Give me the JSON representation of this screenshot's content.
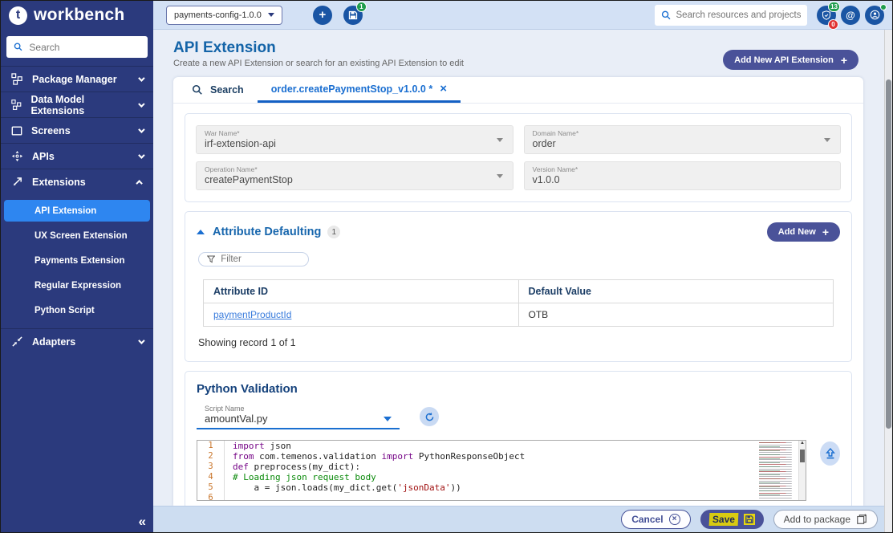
{
  "colors": {
    "navy": "#2b3a7d",
    "selected_blue": "#2e86f0",
    "indigo_button": "#4a5299",
    "title_blue": "#1464a8",
    "tab_active": "#1b6fd1",
    "link_blue": "#3b7ddd",
    "topbar_bg": "#d3e1f5",
    "footer_bg": "#cdddf1",
    "badge_green": "#1f9d4d",
    "badge_red": "#e03131",
    "save_highlight": "#d8ca12"
  },
  "glyphs": {
    "logo": "t",
    "plus": "+",
    "at": "@",
    "collapse": "«",
    "close": "×",
    "save_plus": "+"
  },
  "topbar": {
    "logo_text": "workbench",
    "project_selector": "payments-config-1.0.0",
    "package_badge": "1",
    "search_placeholder": "Search resources and projects",
    "notif_badge_top": "13",
    "notif_badge_bottom": "0"
  },
  "sidebar": {
    "search_placeholder": "Search",
    "items": [
      {
        "label": "Package Manager"
      },
      {
        "label": "Data Model Extensions"
      },
      {
        "label": "Screens"
      },
      {
        "label": "APIs"
      },
      {
        "label": "Extensions"
      },
      {
        "label": "Adapters"
      }
    ],
    "extensions_children": [
      {
        "label": "API Extension",
        "active": true
      },
      {
        "label": "UX Screen Extension"
      },
      {
        "label": "Payments Extension"
      },
      {
        "label": "Regular Expression"
      },
      {
        "label": "Python Script"
      }
    ]
  },
  "page": {
    "title": "API Extension",
    "subtitle": "Create a new API Extension or search for an existing API Extension to edit",
    "add_button": "Add New API Extension"
  },
  "tabs": [
    {
      "label": "Search"
    },
    {
      "label": "order.createPaymentStop_v1.0.0 *",
      "active": true
    }
  ],
  "form": {
    "fields": [
      {
        "label": "War Name*",
        "value": "irf-extension-api"
      },
      {
        "label": "Domain Name*",
        "value": "order"
      },
      {
        "label": "Operation Name*",
        "value": "createPaymentStop"
      },
      {
        "label": "Version Name*",
        "value": "v1.0.0"
      }
    ]
  },
  "attribute_defaulting": {
    "title": "Attribute Defaulting",
    "count": "1",
    "add_button": "Add New",
    "filter_placeholder": "Filter",
    "table": {
      "headers": [
        "Attribute ID",
        "Default Value"
      ],
      "rows": [
        [
          "paymentProductId",
          "OTB"
        ]
      ]
    },
    "footer": "Showing record 1 of 1"
  },
  "python_validation": {
    "title": "Python Validation",
    "script_label": "Script Name",
    "script_value": "amountVal.py",
    "code_lines": [
      {
        "num": "1",
        "tokens": [
          {
            "c": "kw",
            "t": "import"
          },
          {
            "c": "p",
            "t": " json"
          }
        ]
      },
      {
        "num": "2",
        "tokens": [
          {
            "c": "kw",
            "t": "from"
          },
          {
            "c": "p",
            "t": " com.temenos.validation "
          },
          {
            "c": "kw",
            "t": "import"
          },
          {
            "c": "p",
            "t": " PythonResponseObject"
          }
        ]
      },
      {
        "num": "3",
        "tokens": [
          {
            "c": "kw",
            "t": "def"
          },
          {
            "c": "p",
            "t": " preprocess(my_dict):"
          }
        ]
      },
      {
        "num": "4",
        "tokens": [
          {
            "c": "comment",
            "t": "# Loading json request body"
          }
        ]
      },
      {
        "num": "5",
        "tokens": [
          {
            "c": "p",
            "t": "    a = json.loads(my_dict.get("
          },
          {
            "c": "str",
            "t": "'jsonData'"
          },
          {
            "c": "p",
            "t": "))"
          }
        ]
      },
      {
        "num": "6",
        "tokens": []
      }
    ]
  },
  "footer": {
    "cancel": "Cancel",
    "save": "Save",
    "add_to_package": "Add to package"
  }
}
